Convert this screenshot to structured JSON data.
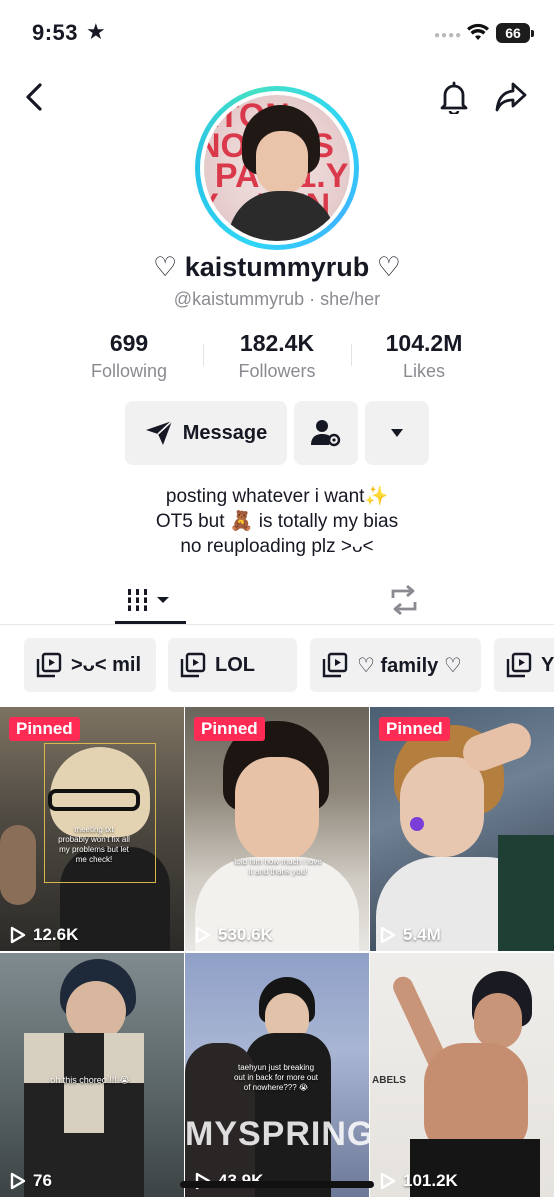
{
  "status_bar": {
    "time": "9:53",
    "battery": "66"
  },
  "profile": {
    "display_name": "♡ kaistummyrub ♡",
    "handle": "@kaistummyrub",
    "pronouns": "she/her",
    "handle_separator": "·"
  },
  "stats": [
    {
      "value": "699",
      "label": "Following"
    },
    {
      "value": "182.4K",
      "label": "Followers"
    },
    {
      "value": "104.2M",
      "label": "Likes"
    }
  ],
  "actions": {
    "message_label": "Message"
  },
  "bio": {
    "line1": "posting whatever i want✨",
    "line2": "OT5 but 🧸 is totally my bias",
    "line3": "no reuploading plz >ᴗ<"
  },
  "playlists": [
    {
      "label": ">ᴗ< mil"
    },
    {
      "label": "LOL"
    },
    {
      "label": "♡ family ♡"
    },
    {
      "label": "Y"
    }
  ],
  "videos": [
    {
      "pinned_label": "Pinned",
      "views": "12.6K",
      "caption": "meeting txt probably won't fix all my problems but let me check!"
    },
    {
      "pinned_label": "Pinned",
      "views": "530.6K",
      "caption": "told him how much i love it and thank you!"
    },
    {
      "pinned_label": "Pinned",
      "views": "5.4M",
      "caption": ""
    },
    {
      "pinned_label": "",
      "views": "76",
      "caption": "oh this choreo !!! 😭"
    },
    {
      "pinned_label": "",
      "views": "43.9K",
      "caption": "taehyun just breaking out in back for more out of nowhere??? 😭"
    },
    {
      "pinned_label": "",
      "views": "101.2K",
      "caption": ""
    }
  ],
  "colors": {
    "pinned": "#fe2c55",
    "ring": "#2fd6f6",
    "text_secondary": "#8a8b91"
  },
  "icons": [
    "back-icon",
    "bell-icon",
    "share-icon",
    "message-icon",
    "add-friend-icon",
    "dropdown-icon",
    "videos-grid-icon",
    "repost-icon",
    "playlist-icon",
    "play-icon"
  ]
}
